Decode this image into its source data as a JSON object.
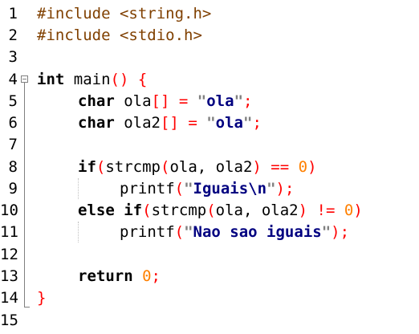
{
  "editor": {
    "line_numbers": [
      "1",
      "2",
      "3",
      "4",
      "5",
      "6",
      "7",
      "8",
      "9",
      "10",
      "11",
      "12",
      "13",
      "14",
      "15"
    ],
    "lines": {
      "l1": {
        "a": "#include ",
        "b": "<string.h>"
      },
      "l2": {
        "a": "#include ",
        "b": "<stdio.h>"
      },
      "l4": {
        "kw": "int",
        "rest": " main",
        "p1": "()",
        "sp": " ",
        "brace": "{"
      },
      "l5": {
        "kw": "char",
        "rest": " ola",
        "br": "[]",
        "sp": " ",
        "eq": "=",
        "sp2": " ",
        "q1": "\"",
        "s": "ola",
        "q2": "\"",
        "semi": ";"
      },
      "l6": {
        "kw": "char",
        "rest": " ola2",
        "br": "[]",
        "sp": " ",
        "eq": "=",
        "sp2": " ",
        "q1": "\"",
        "s": "ola",
        "q2": "\"",
        "semi": ";"
      },
      "l8": {
        "kw": "if",
        "p1": "(",
        "fn": "strcmp",
        "p2": "(",
        "args": "ola, ola2",
        "p3": ")",
        "sp": " ",
        "op": "==",
        "sp2": " ",
        "num": "0",
        "p4": ")"
      },
      "l9": {
        "fn": "printf",
        "p1": "(",
        "q1": "\"",
        "s": "Iguais\\n",
        "q2": "\"",
        "p2": ")",
        "semi": ";"
      },
      "l10": {
        "kw1": "else",
        "sp": " ",
        "kw2": "if",
        "p1": "(",
        "fn": "strcmp",
        "p2": "(",
        "args": "ola, ola2",
        "p3": ")",
        "sp2": " ",
        "op": "!=",
        "sp3": " ",
        "num": "0",
        "p4": ")"
      },
      "l11": {
        "fn": "printf",
        "p1": "(",
        "q1": "\"",
        "s": "Nao sao iguais",
        "q2": "\"",
        "p2": ")",
        "semi": ";"
      },
      "l13": {
        "kw": "return",
        "sp": " ",
        "num": "0",
        "semi": ";"
      },
      "l14": {
        "brace": "}"
      }
    }
  },
  "colors": {
    "keyword": "#000080",
    "operator": "#ff0000",
    "number": "#ff8000",
    "preprocessor": "#804000",
    "string_quote": "#808080"
  }
}
